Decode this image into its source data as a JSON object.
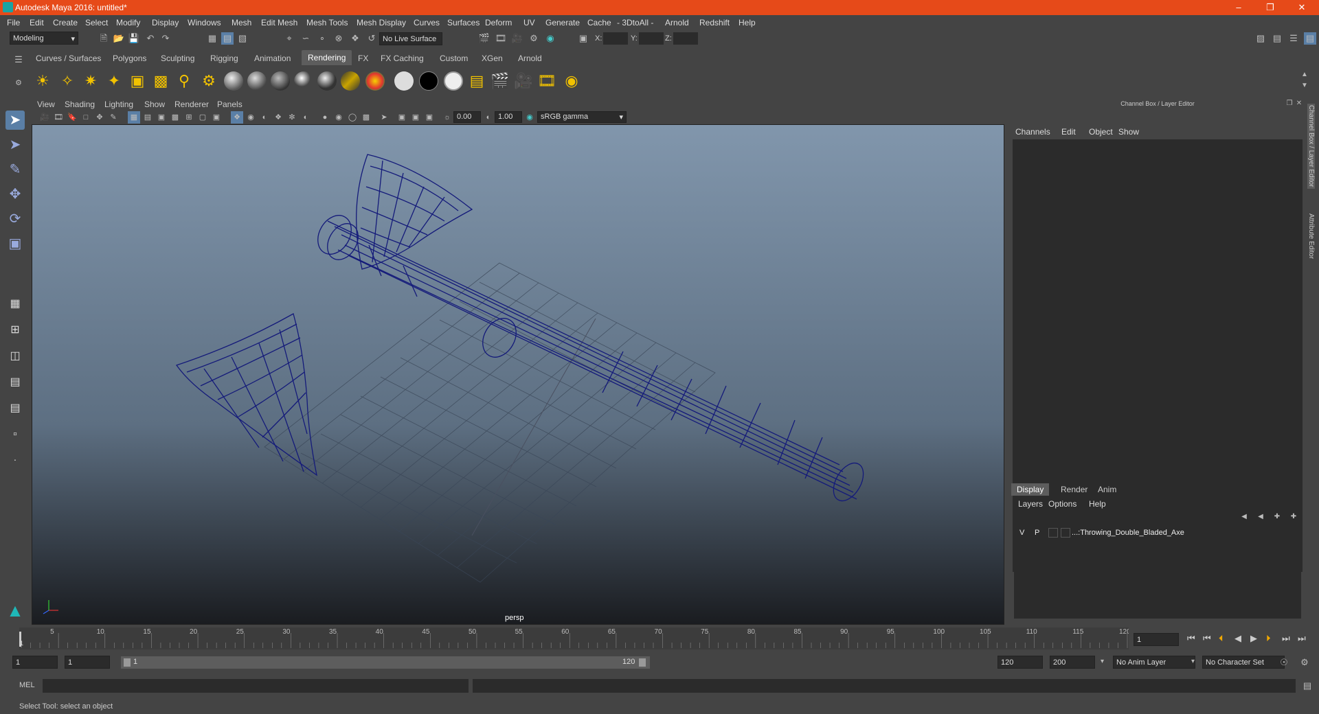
{
  "window": {
    "title": "Autodesk Maya 2016: untitled*"
  },
  "menubar": [
    "File",
    "Edit",
    "Create",
    "Select",
    "Modify",
    "Display",
    "Windows",
    "Mesh",
    "Edit Mesh",
    "Mesh Tools",
    "Mesh Display",
    "Curves",
    "Surfaces",
    "Deform",
    "UV",
    "Generate",
    "Cache",
    "- 3DtoAll -",
    "Arnold",
    "Redshift",
    "Help"
  ],
  "status": {
    "mode": "Modeling",
    "live_surface": "No Live Surface",
    "x_label": "X:",
    "y_label": "Y:",
    "z_label": "Z:"
  },
  "shelf_tabs": [
    "Curves / Surfaces",
    "Polygons",
    "Sculpting",
    "Rigging",
    "Animation",
    "Rendering",
    "FX",
    "FX Caching",
    "Custom",
    "XGen",
    "Arnold"
  ],
  "shelf_active": "Rendering",
  "viewport": {
    "menu": [
      "View",
      "Shading",
      "Lighting",
      "Show",
      "Renderer",
      "Panels"
    ],
    "exposure": "0.00",
    "gamma": "1.00",
    "colorspace": "sRGB gamma",
    "camera": "persp"
  },
  "channel_box": {
    "title": "Channel Box / Layer Editor",
    "menu": [
      "Channels",
      "Edit",
      "Object",
      "Show"
    ]
  },
  "layer_editor": {
    "tabs": [
      "Display",
      "Render",
      "Anim"
    ],
    "menu": [
      "Layers",
      "Options",
      "Help"
    ],
    "layer": {
      "v": "V",
      "p": "P",
      "name": "...:Throwing_Double_Bladed_Axe"
    }
  },
  "side_tabs": [
    "Channel Box / Layer Editor",
    "Attribute Editor"
  ],
  "timeline": {
    "ticks": [
      "5",
      "10",
      "15",
      "20",
      "25",
      "30",
      "35",
      "40",
      "45",
      "50",
      "55",
      "60",
      "65",
      "70",
      "75",
      "80",
      "85",
      "90",
      "95",
      "100",
      "105",
      "110",
      "115",
      "120"
    ],
    "start": "1",
    "current": "1"
  },
  "range": {
    "start": "1",
    "start2": "1",
    "slider_start": "1",
    "slider_end": "120",
    "end": "120",
    "end2": "200",
    "anim_layer": "No Anim Layer",
    "char_set": "No Character Set"
  },
  "cmd": {
    "label": "MEL"
  },
  "help_line": "Select Tool: select an object"
}
